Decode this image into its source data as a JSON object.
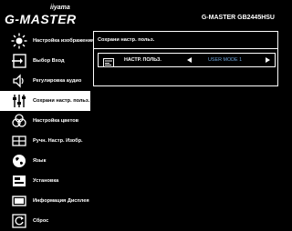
{
  "header": {
    "brand_small": "iiyama",
    "brand_main": "G-MASTER",
    "model": "G-MASTER GB2445HSU"
  },
  "sidebar": {
    "active_index": 3,
    "items": [
      {
        "label": "Настройка изображения",
        "icon": "sun-icon"
      },
      {
        "label": "Выбор Вход",
        "icon": "input-select-icon"
      },
      {
        "label": "Регулировка аудио",
        "icon": "speaker-icon"
      },
      {
        "label": "Сохрани настр. польз.",
        "icon": "sliders-icon"
      },
      {
        "label": "Настройка цветов",
        "icon": "color-circles-icon"
      },
      {
        "label": "Ручн. Настр. Изобр.",
        "icon": "manual-image-icon"
      },
      {
        "label": "Язык",
        "icon": "globe-icon"
      },
      {
        "label": "Установка",
        "icon": "setup-icon"
      },
      {
        "label": "Информация Дисплея",
        "icon": "display-info-icon"
      },
      {
        "label": "Сброс",
        "icon": "reset-icon"
      }
    ]
  },
  "panel": {
    "title": "Сохрани настр. польз.",
    "row_label": "НАСТР. ПОЛЬЗ.",
    "row_value": "USER MODE 1",
    "row_icon": "user-settings-icon"
  },
  "colors": {
    "background": "#000000",
    "foreground": "#ffffff",
    "value_text": "#6ea3d8"
  }
}
